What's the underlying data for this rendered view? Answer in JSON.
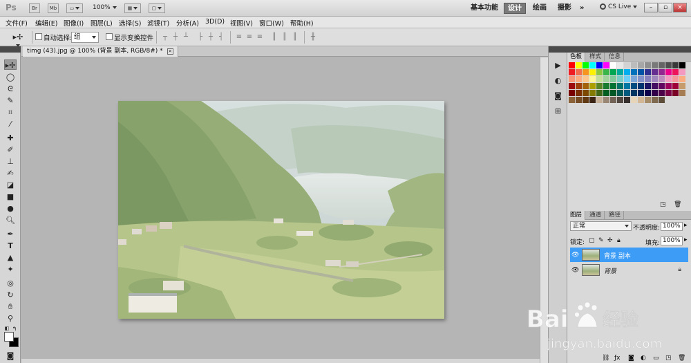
{
  "app": {
    "logo": "Ps",
    "bridge_label": "Br",
    "minibridge_label": "Mb",
    "zoom": "100%",
    "workspaces": [
      "基本功能",
      "设计",
      "绘画",
      "摄影"
    ],
    "active_workspace": "设计",
    "more": "»",
    "cs_live": "CS Live",
    "win_min": "–",
    "win_restore": "▫",
    "win_close": "×"
  },
  "menu": [
    "文件(F)",
    "编辑(E)",
    "图像(I)",
    "图层(L)",
    "选择(S)",
    "滤镜(T)",
    "分析(A)",
    "3D(D)",
    "视图(V)",
    "窗口(W)",
    "帮助(H)"
  ],
  "options": {
    "auto_select_label": "自动选择:",
    "auto_select_value": "组",
    "show_transform_label": "显示变换控件"
  },
  "document": {
    "tab_title": "timg (43).jpg @ 100% (背景 副本, RGB/8#) *",
    "tab_close": "×"
  },
  "swatch_panel": {
    "tabs": [
      "色板",
      "样式",
      "信息"
    ],
    "active": "色板",
    "colors": [
      "#ff0000",
      "#ffff00",
      "#00ff00",
      "#00ffff",
      "#0000ff",
      "#ff00ff",
      "#ffffff",
      "#e8e8e8",
      "#d2d2d2",
      "#bcbcbc",
      "#a6a6a6",
      "#909090",
      "#7a7a7a",
      "#646464",
      "#4e4e4e",
      "#383838",
      "#000000",
      "#ee1d24",
      "#f26c4f",
      "#f7941d",
      "#fff200",
      "#8dc63f",
      "#39b54a",
      "#00a651",
      "#00a99d",
      "#00aeef",
      "#0072bc",
      "#0054a6",
      "#2e3192",
      "#662d91",
      "#92278f",
      "#ec008c",
      "#ed145b",
      "#f49ac1",
      "#f7977a",
      "#fbad82",
      "#fdc68c",
      "#fff799",
      "#c4df9b",
      "#a3d39c",
      "#82ca9c",
      "#7accc8",
      "#6dcff6",
      "#7da7d9",
      "#8393ca",
      "#8781bd",
      "#a187be",
      "#bd8cbf",
      "#f49bc1",
      "#f5989d",
      "#f9ad81",
      "#9e0b0f",
      "#a0410d",
      "#a3620a",
      "#aba000",
      "#598527",
      "#197b30",
      "#007236",
      "#00746b",
      "#0076a3",
      "#004b80",
      "#003471",
      "#1b1464",
      "#440e62",
      "#630460",
      "#9e005d",
      "#9e0039",
      "#c69c6d",
      "#790000",
      "#7b2e00",
      "#7d4900",
      "#827b00",
      "#406618",
      "#005e20",
      "#005826",
      "#005952",
      "#005b7f",
      "#003663",
      "#002157",
      "#0d004c",
      "#32004b",
      "#4b0049",
      "#7b0046",
      "#7a0026",
      "#a67c52",
      "#8c6239",
      "#754c24",
      "#603913",
      "#3c2415",
      "#c7b299",
      "#998675",
      "#736357",
      "#534741",
      "#362f2d",
      "#e6d5b8",
      "#d4b896",
      "#a68c69",
      "#7f6a4f",
      "#5e4d38"
    ]
  },
  "layers_panel": {
    "tabs": [
      "图层",
      "通道",
      "路径"
    ],
    "active": "图层",
    "blend_mode": "正常",
    "opacity_label": "不透明度:",
    "opacity": "100%",
    "lock_label": "锁定:",
    "fill_label": "填充:",
    "fill": "100%",
    "layers": [
      {
        "name": "背景 副本",
        "selected": true,
        "locked": false
      },
      {
        "name": "背景",
        "selected": false,
        "locked": true
      }
    ]
  },
  "watermark": {
    "brand": "Baidu 经验",
    "url": "jingyan.baidu.com"
  }
}
